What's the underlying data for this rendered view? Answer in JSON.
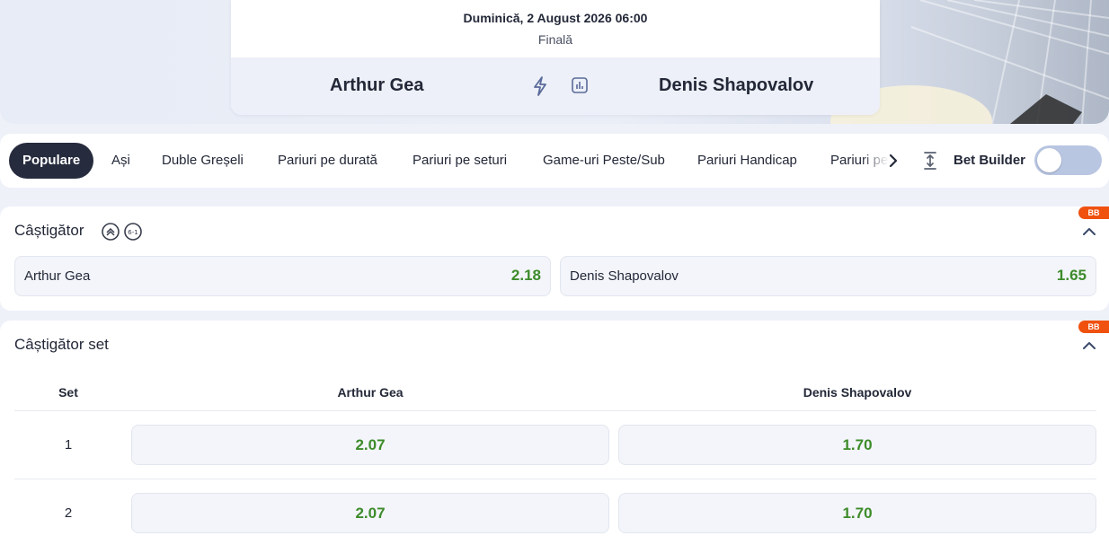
{
  "match": {
    "date": "Duminică, 2 August 2026 06:00",
    "status": "Finală",
    "home_team": "Arthur Gea",
    "away_team": "Denis Shapovalov"
  },
  "tabs": [
    {
      "label": "Populare",
      "active": true
    },
    {
      "label": "Ași"
    },
    {
      "label": "Duble Greșeli"
    },
    {
      "label": "Pariuri pe durată"
    },
    {
      "label": "Pariuri pe seturi"
    },
    {
      "label": "Game-uri Peste/Sub"
    },
    {
      "label": "Pariuri Handicap"
    },
    {
      "label": "Pariuri pe seturi exacte"
    }
  ],
  "bet_builder": {
    "label": "Bet Builder",
    "enabled": false
  },
  "markets": {
    "winner": {
      "title": "Câștigător",
      "badge": "BB",
      "outcomes": [
        {
          "name": "Arthur Gea",
          "odd": "2.18"
        },
        {
          "name": "Denis Shapovalov",
          "odd": "1.65"
        }
      ]
    },
    "set_winner": {
      "title": "Câștigător set",
      "badge": "BB",
      "columns": {
        "set": "Set",
        "home": "Arthur Gea",
        "away": "Denis Shapovalov"
      },
      "rows": [
        {
          "set": "1",
          "home": "2.07",
          "away": "1.70"
        },
        {
          "set": "2",
          "home": "2.07",
          "away": "1.70"
        }
      ]
    }
  },
  "colors": {
    "accent": "#262b3d",
    "odds": "#3d8b2a",
    "badge": "#f0510f",
    "toggle": "#b9c6e2"
  }
}
